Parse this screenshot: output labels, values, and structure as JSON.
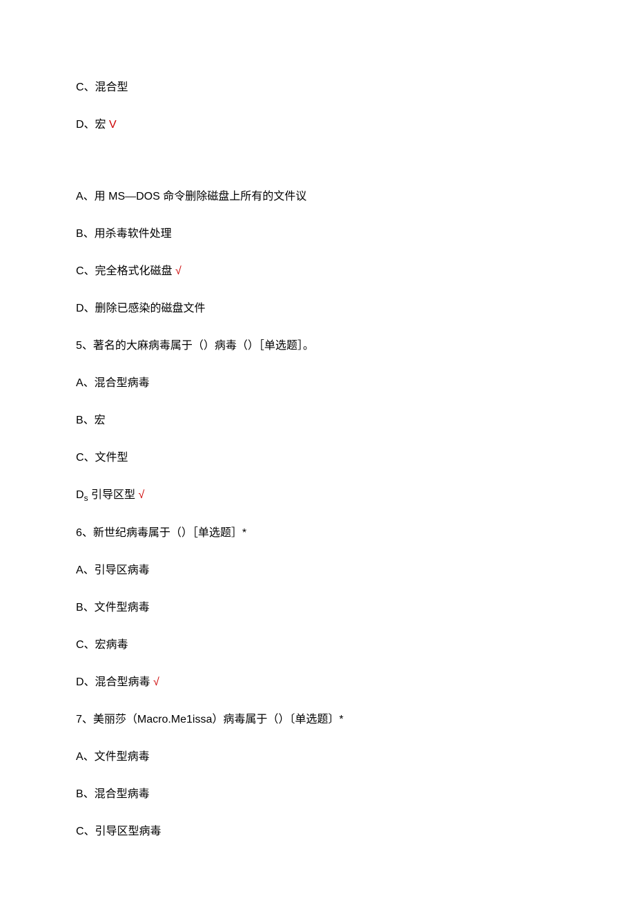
{
  "lines": [
    {
      "text": "C、混合型",
      "correct": false
    },
    {
      "text": "D、宏",
      "correct": true,
      "mark": "V"
    },
    {
      "spacer": true
    },
    {
      "text": "A、用 MS—DOS 命令删除磁盘上所有的文件议",
      "correct": false
    },
    {
      "text": "B、用杀毒软件处理",
      "correct": false
    },
    {
      "text": "C、完全格式化磁盘",
      "correct": true,
      "mark": "√"
    },
    {
      "text": "D、删除已感染的磁盘文件",
      "correct": false
    },
    {
      "text": "5、著名的大麻病毒属于（）病毒（）［单选题］。",
      "correct": false
    },
    {
      "text": "A、混合型病毒",
      "correct": false
    },
    {
      "text": "B、宏",
      "correct": false
    },
    {
      "text": "C、文件型",
      "correct": false
    },
    {
      "text_pre": "D",
      "sub": "s",
      "text_post": " 引导区型",
      "correct": true,
      "mark": "√"
    },
    {
      "text": "6、新世纪病毒属于（）［单选题］*",
      "correct": false
    },
    {
      "text": "A、引导区病毒",
      "correct": false
    },
    {
      "text": "B、文件型病毒",
      "correct": false
    },
    {
      "text": "C、宏病毒",
      "correct": false
    },
    {
      "text": "D、混合型病毒",
      "correct": true,
      "mark": "√"
    },
    {
      "text": "7、美丽莎（Macro.Me1issa）病毒属于（）〔单选题〕*",
      "correct": false
    },
    {
      "text": "A、文件型病毒",
      "correct": false
    },
    {
      "text": "B、混合型病毒",
      "correct": false
    },
    {
      "text": "C、引导区型病毒",
      "correct": false
    }
  ]
}
